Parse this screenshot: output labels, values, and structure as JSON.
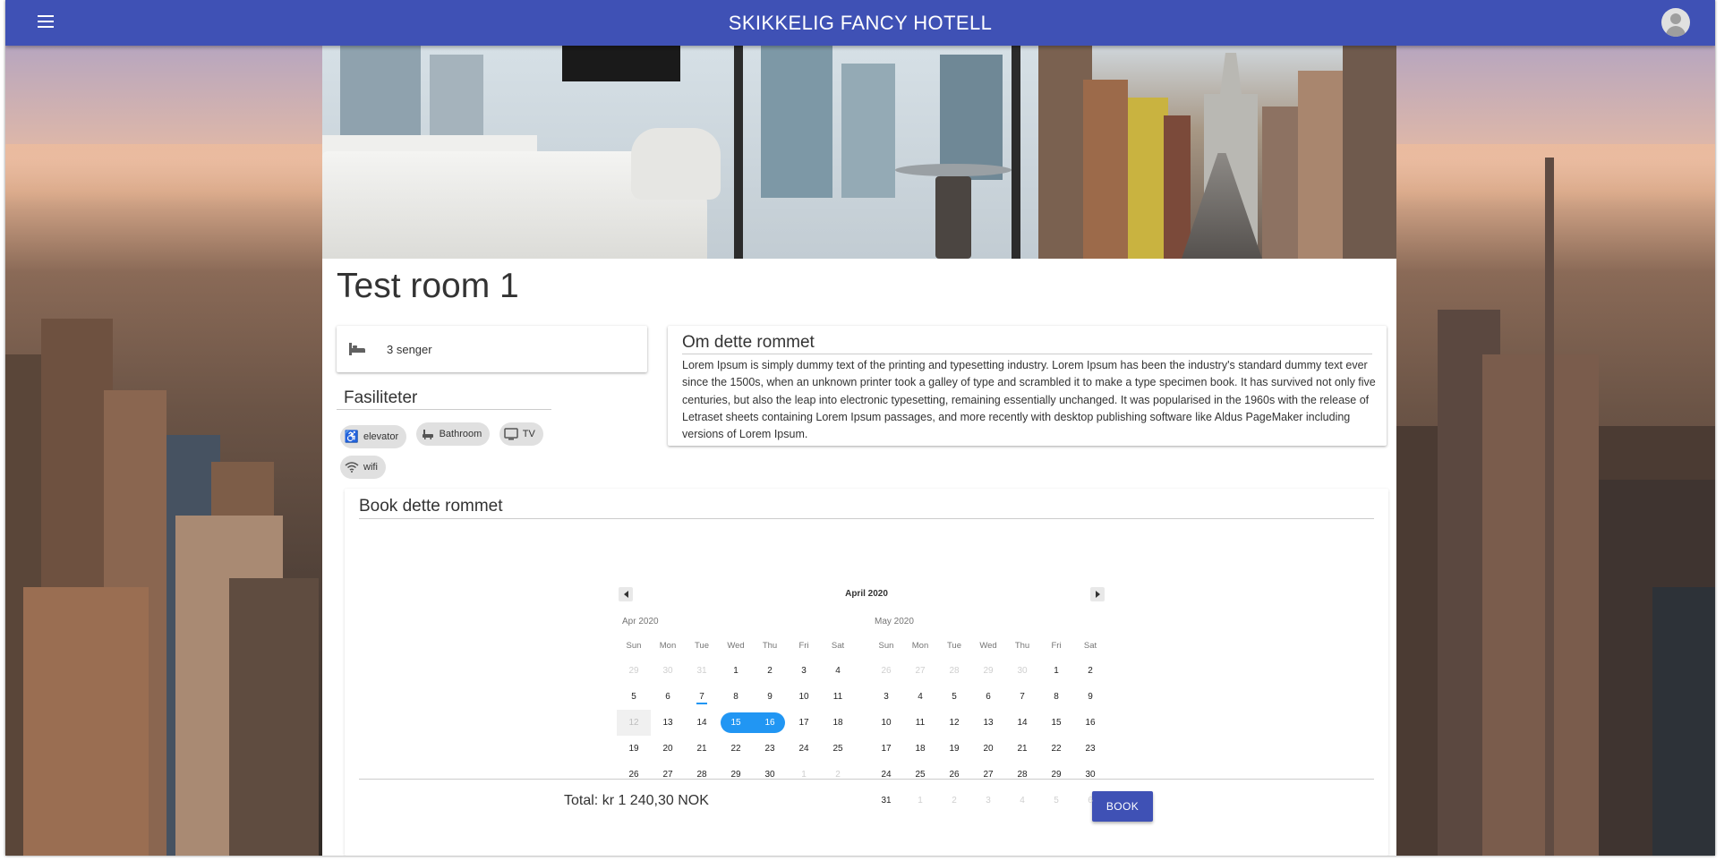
{
  "app": {
    "title": "SKIKKELIG FANCY HOTELL"
  },
  "room": {
    "title": "Test room 1",
    "beds_label": "3 senger"
  },
  "facilities": {
    "title": "Fasiliteter",
    "items": [
      {
        "label": "elevator",
        "icon": "accessible-icon"
      },
      {
        "label": "Bathroom",
        "icon": "bathtub-icon"
      },
      {
        "label": "TV",
        "icon": "tv-icon"
      },
      {
        "label": "wifi",
        "icon": "wifi-icon"
      }
    ]
  },
  "about": {
    "title": "Om dette rommet",
    "text": "Lorem Ipsum is simply dummy text of the printing and typesetting industry. Lorem Ipsum has been the industry's standard dummy text ever since the 1500s, when an unknown printer took a galley of type and scrambled it to make a type specimen book. It has survived not only five centuries, but also the leap into electronic typesetting, remaining essentially unchanged. It was popularised in the 1960s with the release of Letraset sheets containing Lorem Ipsum passages, and more recently with desktop publishing software like Aldus PageMaker including versions of Lorem Ipsum."
  },
  "booking": {
    "title": "Book dette rommet",
    "calendar_header": "April 2020",
    "weekdays": [
      "Sun",
      "Mon",
      "Tue",
      "Wed",
      "Thu",
      "Fri",
      "Sat"
    ],
    "months": [
      {
        "name": "Apr 2020",
        "weeks": [
          [
            "29",
            "30",
            "31",
            "1",
            "2",
            "3",
            "4"
          ],
          [
            "5",
            "6",
            "7",
            "8",
            "9",
            "10",
            "11"
          ],
          [
            "12",
            "13",
            "14",
            "15",
            "16",
            "17",
            "18"
          ],
          [
            "19",
            "20",
            "21",
            "22",
            "23",
            "24",
            "25"
          ],
          [
            "26",
            "27",
            "28",
            "29",
            "30",
            "1",
            "2"
          ]
        ],
        "muted": [
          "0-0",
          "0-1",
          "0-2",
          "4-5",
          "4-6"
        ],
        "disabled": [
          "2-0"
        ],
        "today": "1-2",
        "selected": [
          "2-3",
          "2-4"
        ]
      },
      {
        "name": "May 2020",
        "weeks": [
          [
            "26",
            "27",
            "28",
            "29",
            "30",
            "1",
            "2"
          ],
          [
            "3",
            "4",
            "5",
            "6",
            "7",
            "8",
            "9"
          ],
          [
            "10",
            "11",
            "12",
            "13",
            "14",
            "15",
            "16"
          ],
          [
            "17",
            "18",
            "19",
            "20",
            "21",
            "22",
            "23"
          ],
          [
            "24",
            "25",
            "26",
            "27",
            "28",
            "29",
            "30"
          ],
          [
            "31",
            "1",
            "2",
            "3",
            "4",
            "5",
            "6"
          ]
        ],
        "muted": [
          "0-0",
          "0-1",
          "0-2",
          "0-3",
          "0-4",
          "5-1",
          "5-2",
          "5-3",
          "5-4",
          "5-5",
          "5-6"
        ],
        "disabled": [],
        "today": null,
        "selected": []
      }
    ],
    "total_label": "Total: kr 1 240,30 NOK",
    "book_label": "BOOK"
  },
  "colors": {
    "primary": "#3f51b5",
    "selection": "#2196f3"
  }
}
